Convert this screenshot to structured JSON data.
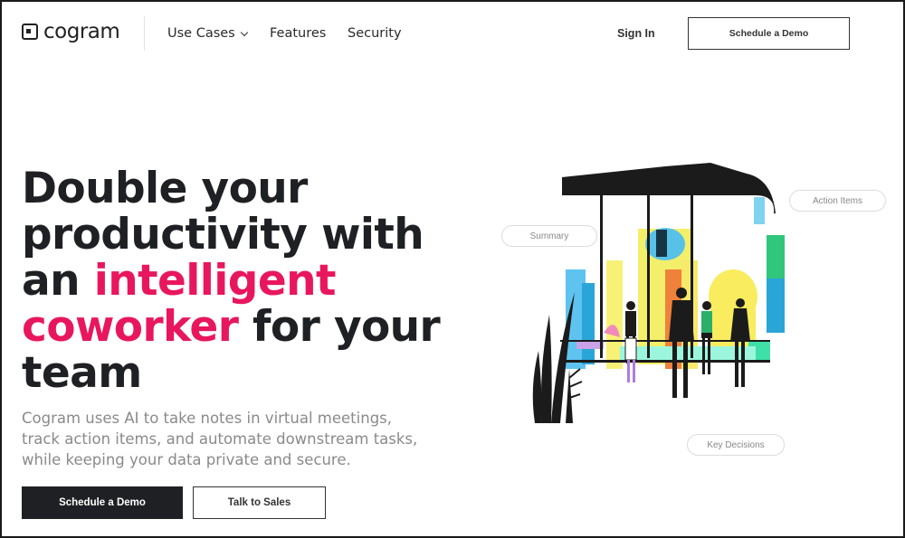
{
  "header": {
    "logo_text": "cogram",
    "nav": {
      "use_cases": "Use Cases",
      "features": "Features",
      "security": "Security"
    },
    "sign_in": "Sign In",
    "schedule_demo": "Schedule a Demo"
  },
  "hero": {
    "headline_1": "Double your productivity with an ",
    "headline_accent": "intelligent coworker",
    "headline_2": " for your team",
    "subtext": "Cogram uses AI to take notes in virtual meetings, track action items, and automate downstream tasks, while keeping your data private and secure.",
    "primary_button": "Schedule a Demo",
    "secondary_button": "Talk to Sales"
  },
  "illustration": {
    "tags": {
      "summary": "Summary",
      "action_items": "Action Items",
      "key_decisions": "Key Decisions"
    }
  },
  "colors": {
    "accent": "#e8175d",
    "dark": "#1f2023",
    "muted_text": "#8a8a8a"
  }
}
